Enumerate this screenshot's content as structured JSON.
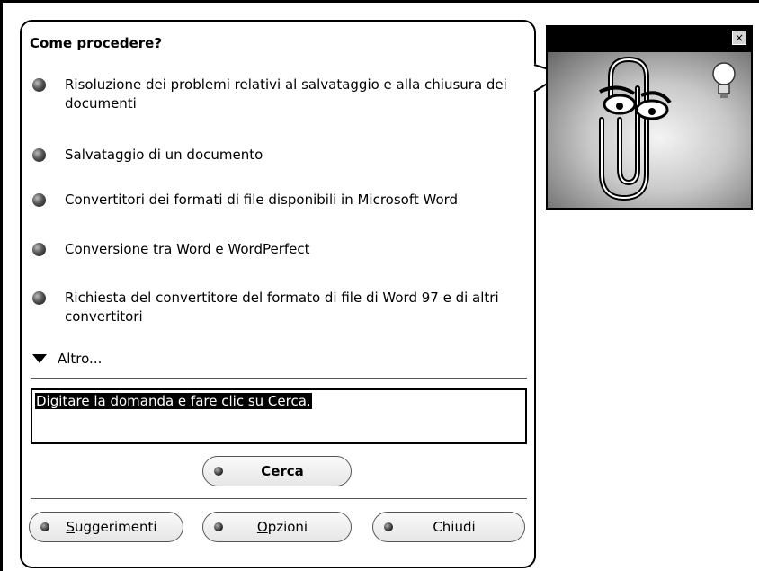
{
  "balloon": {
    "title": "Come procedere?",
    "bullets": [
      {
        "text": "Risoluzione dei problemi relativi al salvataggio e alla chiusura dei documenti"
      },
      {
        "text": "Salvataggio di un documento"
      },
      {
        "text": "Convertitori dei formati di file disponibili in Microsoft Word"
      },
      {
        "text": "Conversione tra Word e WordPerfect"
      },
      {
        "text": "Richiesta del convertitore del formato di file di Word 97 e di altri convertitori"
      }
    ],
    "more_label": "Altro...",
    "question_text": "Digitare la domanda e fare clic su Cerca.",
    "search_button": {
      "accel": "C",
      "rest": "erca"
    },
    "tips_button": {
      "accel": "S",
      "rest": "uggerimenti"
    },
    "options_button": {
      "accel": "O",
      "rest": "pzioni"
    },
    "close_button": {
      "label": "Chiudi"
    }
  },
  "assistant": {
    "close_glyph": "×",
    "character_icon": "paperclip-icon",
    "idea_icon": "lightbulb-icon"
  }
}
